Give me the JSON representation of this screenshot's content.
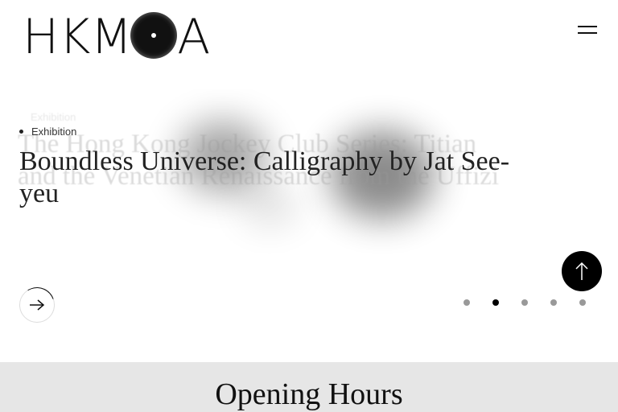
{
  "header": {
    "logo_left": "HKM",
    "logo_right": "A",
    "menu_icon": "hamburger-icon"
  },
  "slider": {
    "ghost_slide": {
      "category": "Exhibition",
      "title": "The Hong Kong Jockey Club Series: Titian and the Venetian Renaissance from the Uffizi"
    },
    "active_slide": {
      "category": "Exhibition",
      "title": "Boundless Universe: Calligraphy by Jat See-yeu"
    },
    "next_icon": "arrow-right-icon",
    "back_to_top_icon": "arrow-up-icon",
    "dots": {
      "count": 5,
      "active_index": 1
    }
  },
  "opening_hours": {
    "title": "Opening Hours"
  },
  "colors": {
    "background": "#ffffff",
    "text": "#111111",
    "band": "#e6e6e6",
    "dot_inactive": "#999999",
    "dot_active": "#000000"
  }
}
